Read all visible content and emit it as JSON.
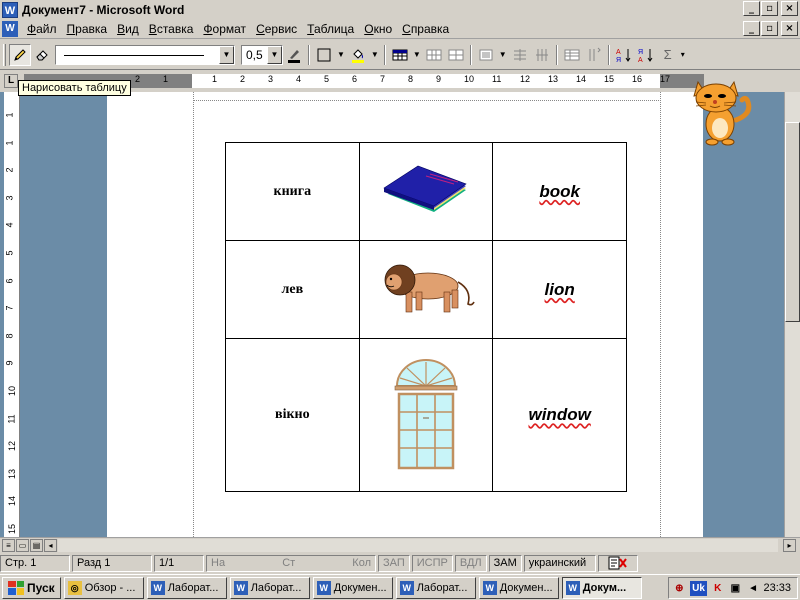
{
  "window": {
    "title": "Документ7 - Microsoft Word",
    "app_icon": "word-icon",
    "controls": [
      "_",
      "▫",
      "×"
    ]
  },
  "menu": {
    "items": [
      "Файл",
      "Правка",
      "Вид",
      "Вставка",
      "Формат",
      "Сервис",
      "Таблица",
      "Окно",
      "Справка"
    ],
    "doc_controls": [
      "_",
      "▫",
      "×"
    ]
  },
  "toolbar": {
    "line_weight": "0,5",
    "tools": [
      "pencil-icon",
      "eraser-icon",
      "line-style-combo",
      "line-weight-combo",
      "border-color-icon",
      "borders-icon",
      "shading-icon",
      "insert-table-icon",
      "merge-cells-icon",
      "split-cells-icon",
      "align-icon",
      "distribute-rows-icon",
      "distribute-columns-icon",
      "autoformat-icon",
      "text-direction-icon",
      "sort-ascending-icon",
      "sort-descending-icon",
      "autosum-icon"
    ]
  },
  "ruler": {
    "corner": "L",
    "numbers": [
      "2",
      "1",
      "1",
      "2",
      "3",
      "4",
      "5",
      "6",
      "7",
      "8",
      "9",
      "10",
      "11",
      "12",
      "13",
      "14",
      "15",
      "16",
      "17"
    ]
  },
  "tooltip": "Нарисовать таблицу",
  "vruler": {
    "numbers": [
      "1",
      "1",
      "2",
      "3",
      "4",
      "5",
      "6",
      "7",
      "8",
      "9",
      "10",
      "11",
      "12",
      "13",
      "14",
      "15"
    ]
  },
  "table": {
    "rows": [
      {
        "ua": "книга",
        "picture": "book-image",
        "en": "book"
      },
      {
        "ua": "лев",
        "picture": "lion-image",
        "en": "lion"
      },
      {
        "ua": "вікно",
        "picture": "window-image",
        "en": "window"
      }
    ]
  },
  "assistant": "cat-office-assistant",
  "status": {
    "page": "Стр. 1",
    "section": "Разд 1",
    "pages": "1/1",
    "at": "На",
    "line": "Ст",
    "col": "Кол",
    "rec": "ЗАП",
    "trk": "ИСПР",
    "ext": "ВДЛ",
    "ovr": "ЗАМ",
    "language": "украинский"
  },
  "taskbar": {
    "start": "Пуск",
    "tasks": [
      {
        "label": "Обзор - ...",
        "icon": "explorer-icon",
        "active": false
      },
      {
        "label": "Лаборат...",
        "icon": "word-doc-icon",
        "active": false
      },
      {
        "label": "Лаборат...",
        "icon": "word-doc-icon",
        "active": false
      },
      {
        "label": "Докумен...",
        "icon": "word-doc-icon",
        "active": false
      },
      {
        "label": "Лаборат...",
        "icon": "word-doc-icon",
        "active": false
      },
      {
        "label": "Докумен...",
        "icon": "word-doc-icon",
        "active": false
      },
      {
        "label": "Докум...",
        "icon": "word-doc-icon",
        "active": true
      }
    ],
    "tray_lang": "Uk",
    "clock": "23:33"
  },
  "colors": {
    "workspace": "#6b8ca7",
    "ui_face": "#d4d0c8",
    "tooltip_bg": "#ffffe1",
    "spell_underline": "#d22222"
  }
}
